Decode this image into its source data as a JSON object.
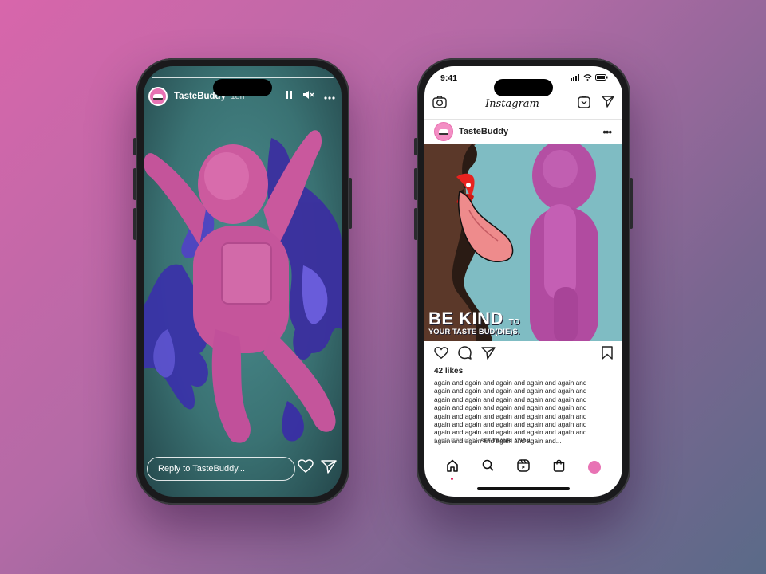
{
  "story": {
    "username": "TasteBuddy",
    "time": "18h",
    "reply_placeholder": "Reply to TasteBuddy...",
    "icons": [
      "pause-icon",
      "mute-icon",
      "more-icon",
      "heart-icon",
      "send-icon"
    ]
  },
  "feed": {
    "status_time": "9:41",
    "app_title": "Instagram",
    "username": "TasteBuddy",
    "more": "•••",
    "image_text_line1": "BE KIND",
    "image_text_to": "TO",
    "image_text_line2": "YOUR TASTE BUD(DIE)S.",
    "likes": "42 likes",
    "caption": "again and again and again and again and again and again and again and again and again and again and again and again and again and again and again and again and again and again and again and again and again and again and again and again and again and again and again and again and again and again and again and again and again and again and again and again and again and again and again and...",
    "timestamp": "9 MINUTES AGO",
    "separator": " • ",
    "see_translation": "SEE TRANSLATION"
  },
  "colors": {
    "brand_pink": "#e873b4",
    "background_start": "#d866ab",
    "background_end": "#5a6a88",
    "post_bg": "#7fbcc3"
  }
}
